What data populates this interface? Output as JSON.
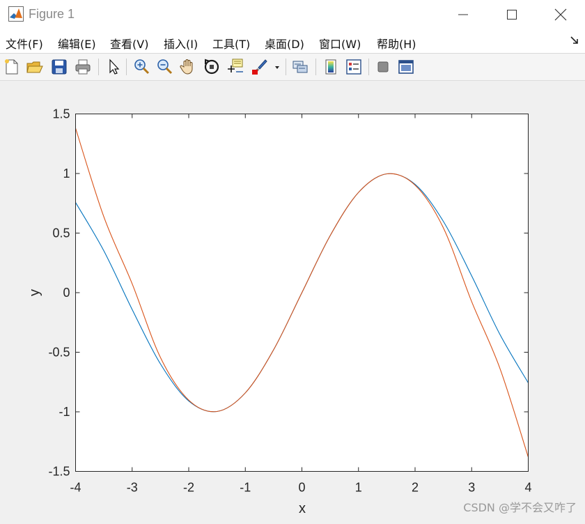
{
  "window": {
    "title": "Figure 1"
  },
  "menu": {
    "items": [
      "文件(F)",
      "编辑(E)",
      "查看(V)",
      "插入(I)",
      "工具(T)",
      "桌面(D)",
      "窗口(W)",
      "帮助(H)"
    ]
  },
  "toolbar": {
    "buttons": [
      "new-figure-icon",
      "open-file-icon",
      "save-icon",
      "print-icon",
      "select-pointer-icon",
      "zoom-in-icon",
      "zoom-out-icon",
      "pan-hand-icon",
      "rotate-3d-icon",
      "data-cursor-icon",
      "brush-icon",
      "brush-dropdown-icon",
      "link-plot-icon",
      "colorbar-icon",
      "legend-icon",
      "hide-plot-tools-icon",
      "show-plot-tools-icon"
    ]
  },
  "colors": {
    "series1": "#0072BD",
    "series2": "#D95319"
  },
  "chart_data": {
    "type": "line",
    "title": "",
    "xlabel": "x",
    "ylabel": "y",
    "xlim": [
      -4,
      4
    ],
    "ylim": [
      -1.5,
      1.5
    ],
    "grid": false,
    "xticks": [
      "-4",
      "-3",
      "-2",
      "-1",
      "0",
      "1",
      "2",
      "3",
      "4"
    ],
    "yticks": [
      "-1.5",
      "-1",
      "-0.5",
      "0",
      "0.5",
      "1",
      "1.5"
    ],
    "x": [
      -4,
      -3.5,
      -3,
      -2.5,
      -2,
      -1.5,
      -1,
      -0.5,
      0,
      0.5,
      1,
      1.5,
      2,
      2.5,
      3,
      3.5,
      4
    ],
    "series": [
      {
        "values": [
          0.757,
          0.351,
          -0.141,
          -0.598,
          -0.909,
          -0.997,
          -0.841,
          -0.479,
          0,
          0.479,
          0.841,
          0.997,
          0.909,
          0.598,
          0.141,
          -0.351,
          -0.757
        ]
      },
      {
        "values": [
          1.38,
          0.636,
          0.075,
          -0.544,
          -0.902,
          -0.997,
          -0.841,
          -0.479,
          0,
          0.479,
          0.841,
          0.997,
          0.902,
          0.544,
          -0.075,
          -0.636,
          -1.38
        ]
      }
    ]
  },
  "watermark": "CSDN @学不会又咋了"
}
